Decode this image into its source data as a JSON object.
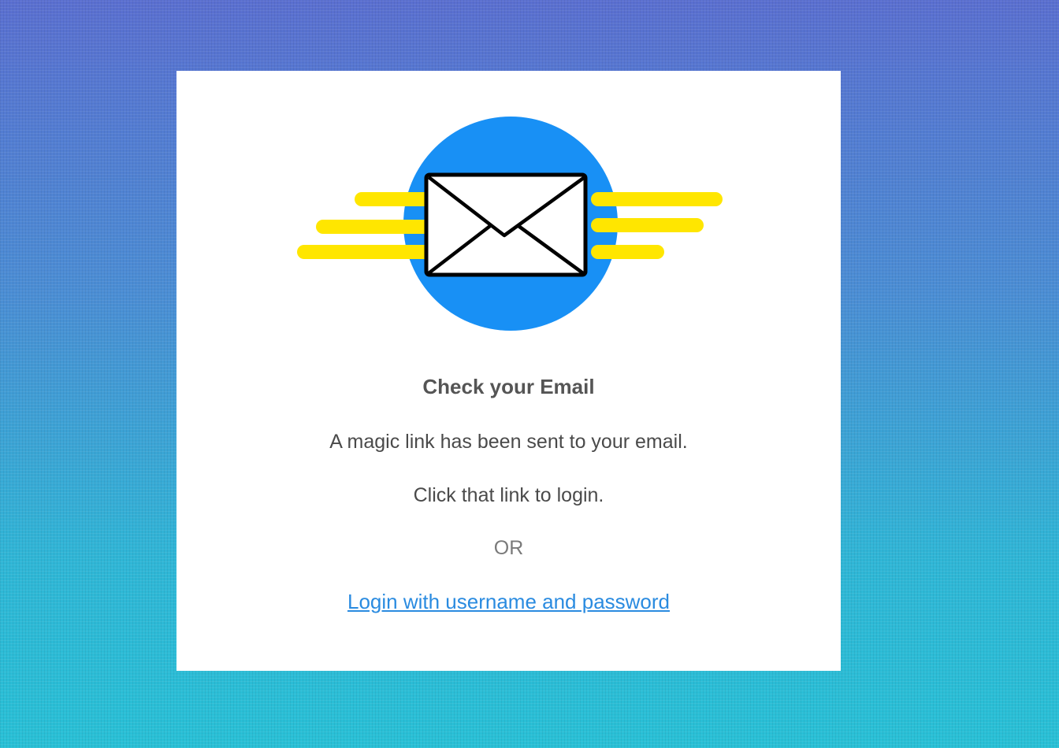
{
  "colors": {
    "circle": "#1890f5",
    "speed_lines": "#ffe600",
    "link": "#2a8be0",
    "title": "#555555"
  },
  "illustration": {
    "icon": "envelope-icon"
  },
  "message": {
    "title": "Check your Email",
    "line1": "A magic link has been sent to your email.",
    "line2": "Click that link to login.",
    "separator": "OR",
    "alt_login_link": "Login with username and password"
  }
}
